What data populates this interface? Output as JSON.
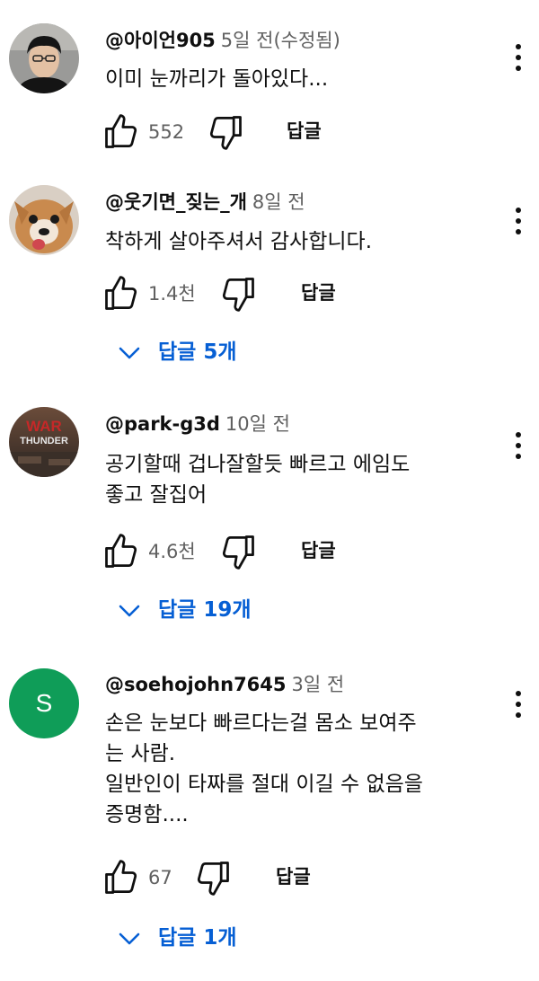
{
  "comments": [
    {
      "author": "@아이언905",
      "time": "5일 전(수정됨)",
      "lines": [
        "이미 눈까리가 돌아있다..."
      ],
      "likes": "552",
      "reply_label": "답글",
      "replies_label": "",
      "avatar": "photo-man-with-glasses"
    },
    {
      "author": "@웃기면_짖는_개",
      "time": "8일 전",
      "lines": [
        "착하게 살아주셔서 감사합니다."
      ],
      "likes": "1.4천",
      "reply_label": "답글",
      "replies_label": "답글 5개",
      "avatar": "photo-small-dog"
    },
    {
      "author": "@park-g3d",
      "time": "10일 전",
      "lines": [
        "공기할때 겁나잘할듯 빠르고 에임도",
        "좋고 잘집어"
      ],
      "likes": "4.6천",
      "reply_label": "답글",
      "replies_label": "답글 19개",
      "avatar": "war-thunder-logo",
      "avatar_text": [
        "WAR",
        "THUNDER"
      ]
    },
    {
      "author": "@soehojohn7645",
      "time": "3일 전",
      "lines": [
        "손은 눈보다 빠르다는걸 몸소 보여주",
        "는 사람.",
        "일반인이 타짜를 절대 이길 수 없음을",
        "증명함...."
      ],
      "likes": "67",
      "reply_label": "답글",
      "replies_label": "답글 1개",
      "avatar": "letter-avatar",
      "avatar_letter": "S"
    }
  ],
  "colors": {
    "link_blue": "#065fd4",
    "secondary_text": "#606060",
    "primary_text": "#0f0f0f",
    "letter_avatar_bg": "#0f9d58"
  },
  "icons": [
    "thumb-up-icon",
    "thumb-down-icon",
    "more-vert-icon",
    "chevron-down-icon"
  ]
}
